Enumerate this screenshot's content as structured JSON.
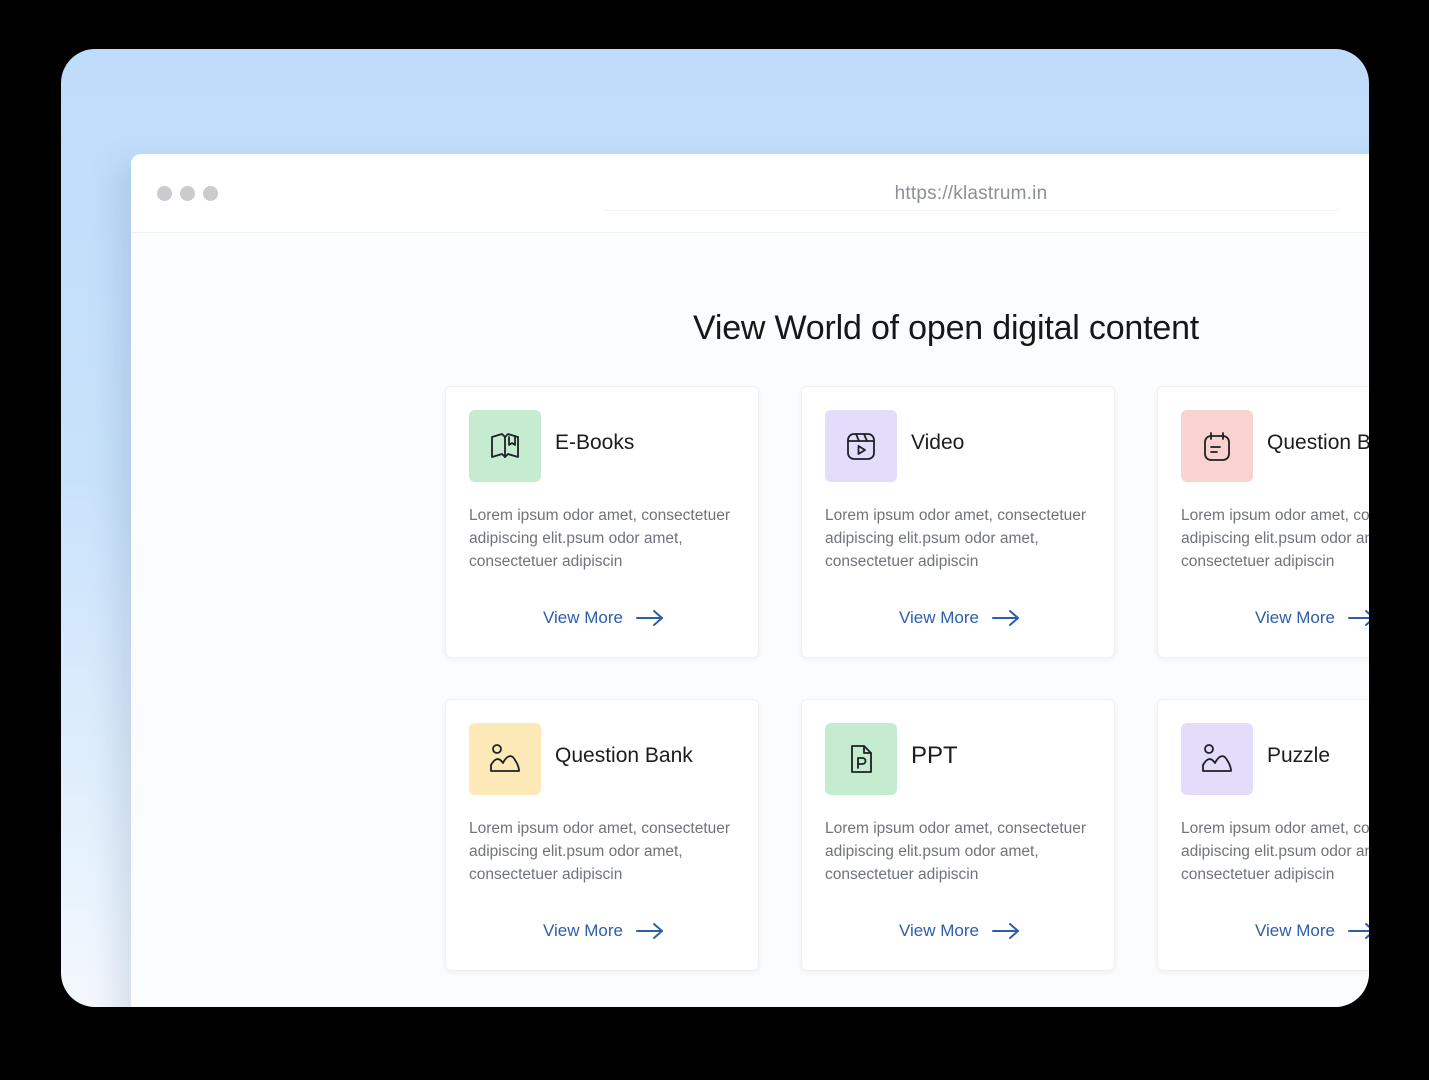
{
  "browser": {
    "url": "https://klastrum.in"
  },
  "page": {
    "heading": "View World of open digital content"
  },
  "colors": {
    "link": "#2c5fa8",
    "green_tile": "#c6ecd0",
    "purple_tile": "#e4dcfb",
    "red_tile": "#f8d3cf",
    "yellow_tile": "#fde8b8"
  },
  "cards": [
    {
      "title": "E-Books",
      "icon": "book-icon",
      "description": "Lorem ipsum odor amet, consectetuer adipiscing elit.psum odor amet, consectetuer adipiscin",
      "link": "View More"
    },
    {
      "title": "Video",
      "icon": "video-icon",
      "description": "Lorem ipsum odor amet, consectetuer adipiscing elit.psum odor amet, consectetuer adipiscin",
      "link": "View More"
    },
    {
      "title": "Question Bank",
      "icon": "notepad-icon",
      "description": "Lorem ipsum odor amet, consectetuer adipiscing elit.psum odor amet, consectetuer adipiscin",
      "link": "View More"
    },
    {
      "title": "Question Bank",
      "icon": "image-icon",
      "description": "Lorem ipsum odor amet, consectetuer adipiscing elit.psum odor amet, consectetuer adipiscin",
      "link": "View More"
    },
    {
      "title": "PPT",
      "icon": "ppt-file-icon",
      "description": "Lorem ipsum odor amet, consectetuer adipiscing elit.psum odor amet, consectetuer adipiscin",
      "link": "View More"
    },
    {
      "title": "Puzzle",
      "icon": "image-icon",
      "description": "Lorem ipsum odor amet, consectetuer adipiscing elit.psum odor amet, consectetuer adipiscin",
      "link": "View More"
    }
  ]
}
